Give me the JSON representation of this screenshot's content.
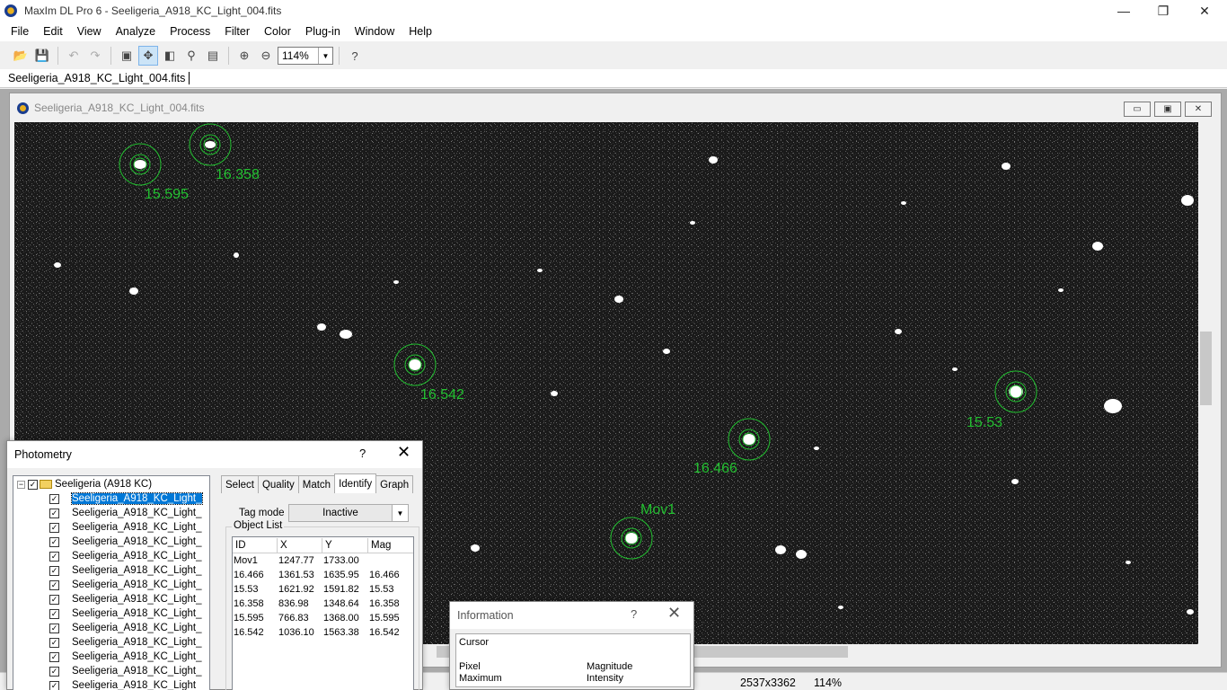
{
  "app": {
    "title": "MaxIm DL Pro 6 - Seeligeria_A918_KC_Light_004.fits",
    "minimize": "—",
    "restore": "❐",
    "close": "✕"
  },
  "menu": [
    "File",
    "Edit",
    "View",
    "Analyze",
    "Process",
    "Filter",
    "Color",
    "Plug-in",
    "Window",
    "Help"
  ],
  "toolbar": {
    "zoom_value": "114%",
    "icons": [
      "open-icon",
      "save-icon",
      "undo-icon",
      "redo-icon",
      "image-icon",
      "pan-icon",
      "flip-icon",
      "pin-icon",
      "properties-icon",
      "zoom-in-icon",
      "zoom-out-icon",
      "help-icon"
    ]
  },
  "doc_tab": "Seeligeria_A918_KC_Light_004.fits",
  "image_window": {
    "title": "Seeligeria_A918_KC_Light_004.fits",
    "labels": [
      {
        "text": "15.595"
      },
      {
        "text": "16.358"
      },
      {
        "text": "16.542"
      },
      {
        "text": "16.466"
      },
      {
        "text": "15.53"
      },
      {
        "text": "Mov1"
      }
    ]
  },
  "status": {
    "dimensions": "2537x3362",
    "zoom": "114%"
  },
  "photometry": {
    "title": "Photometry",
    "help": "?",
    "close": "✕",
    "tree_root": "Seeligeria (A918 KC)",
    "tree_items": [
      "Seeligeria_A918_KC_Light_",
      "Seeligeria_A918_KC_Light_",
      "Seeligeria_A918_KC_Light_",
      "Seeligeria_A918_KC_Light_",
      "Seeligeria_A918_KC_Light_",
      "Seeligeria_A918_KC_Light_",
      "Seeligeria_A918_KC_Light_",
      "Seeligeria_A918_KC_Light_",
      "Seeligeria_A918_KC_Light_",
      "Seeligeria_A918_KC_Light_",
      "Seeligeria_A918_KC_Light_",
      "Seeligeria_A918_KC_Light_",
      "Seeligeria_A918_KC_Light_",
      "Seeligeria_A918_KC_Light"
    ],
    "tabs": [
      "Select",
      "Quality",
      "Match",
      "Identify",
      "Graph"
    ],
    "selected_tab": "Identify",
    "tag_mode_label": "Tag mode",
    "tag_mode_value": "Inactive",
    "object_list_label": "Object List",
    "columns": [
      "ID",
      "X",
      "Y",
      "Mag"
    ],
    "rows": [
      [
        "Mov1",
        "1247.77",
        "1733.00",
        ""
      ],
      [
        "16.466",
        "1361.53",
        "1635.95",
        "16.466"
      ],
      [
        "15.53",
        "1621.92",
        "1591.82",
        "15.53"
      ],
      [
        "16.358",
        "836.98",
        "1348.64",
        "16.358"
      ],
      [
        "15.595",
        "766.83",
        "1368.00",
        "15.595"
      ],
      [
        "16.542",
        "1036.10",
        "1563.38",
        "16.542"
      ]
    ]
  },
  "information": {
    "title": "Information",
    "help": "?",
    "close": "✕",
    "cursor": "Cursor",
    "pixel": "Pixel",
    "maximum": "Maximum",
    "magnitude": "Magnitude",
    "intensity": "Intensity"
  }
}
